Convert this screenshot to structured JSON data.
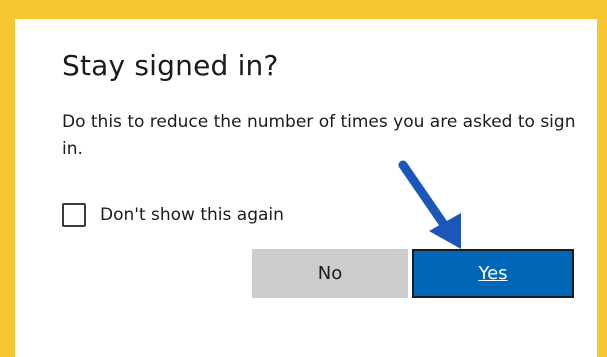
{
  "dialog": {
    "title": "Stay signed in?",
    "description": "Do this to reduce the number of times you are asked to sign in.",
    "checkbox_label": "Don't show this again",
    "checkbox_checked": false,
    "no_label": "No",
    "yes_label": "Yes"
  },
  "colors": {
    "frame_border": "#f6c62f",
    "primary_button": "#0067b8",
    "secondary_button": "#cccccc",
    "annotation_arrow": "#1a57b8"
  },
  "annotation": {
    "arrow_icon": "arrow-down-right-icon"
  }
}
